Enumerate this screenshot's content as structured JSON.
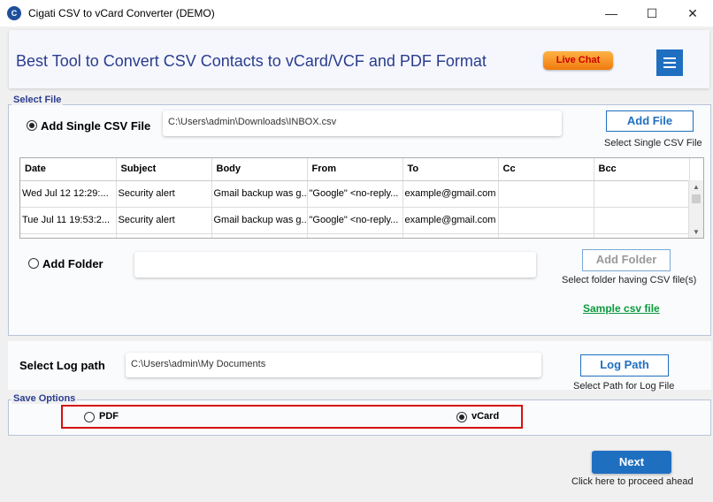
{
  "window": {
    "icon_letter": "C",
    "title": "Cigati CSV to vCard Converter (DEMO)",
    "controls": [
      "—",
      "☐",
      "✕"
    ]
  },
  "header": {
    "title": "Best Tool to Convert CSV Contacts to vCard/VCF and PDF Format",
    "live_chat": "Live Chat"
  },
  "select_file": {
    "legend": "Select File",
    "single_csv_label": "Add Single CSV File",
    "single_csv_path": "C:\\Users\\admin\\Downloads\\INBOX.csv",
    "add_file_button": "Add File",
    "add_file_caption": "Select Single CSV File",
    "add_folder_label": "Add Folder",
    "add_folder_path": "",
    "add_folder_button": "Add Folder",
    "add_folder_caption": "Select folder having CSV file(s)",
    "sample_link": "Sample csv file"
  },
  "table": {
    "columns": [
      "Date",
      "Subject",
      "Body",
      "From",
      "To",
      "Cc",
      "Bcc"
    ],
    "rows": [
      [
        "Wed Jul 12 12:29:...",
        "Security alert",
        "Gmail backup was g...",
        "\"Google\" <no-reply...",
        "example@gmail.com",
        "",
        ""
      ],
      [
        "Tue Jul 11 19:53:2...",
        "Security alert",
        "Gmail backup was g...",
        "\"Google\" <no-reply...",
        "example@gmail.com",
        "",
        ""
      ]
    ]
  },
  "log": {
    "label": "Select Log path",
    "path": "C:\\Users\\admin\\My Documents",
    "button": "Log Path",
    "caption": "Select Path for Log File"
  },
  "save_options": {
    "legend": "Save Options",
    "pdf": "PDF",
    "vcard": "vCard",
    "selected": "vCard"
  },
  "footer": {
    "next_button": "Next",
    "next_caption": "Click here to proceed ahead"
  },
  "colors": {
    "accent": "#1f6fc1",
    "header_text": "#2a3c8f",
    "highlight": "#d80f0f",
    "link": "#0a9a3c"
  }
}
